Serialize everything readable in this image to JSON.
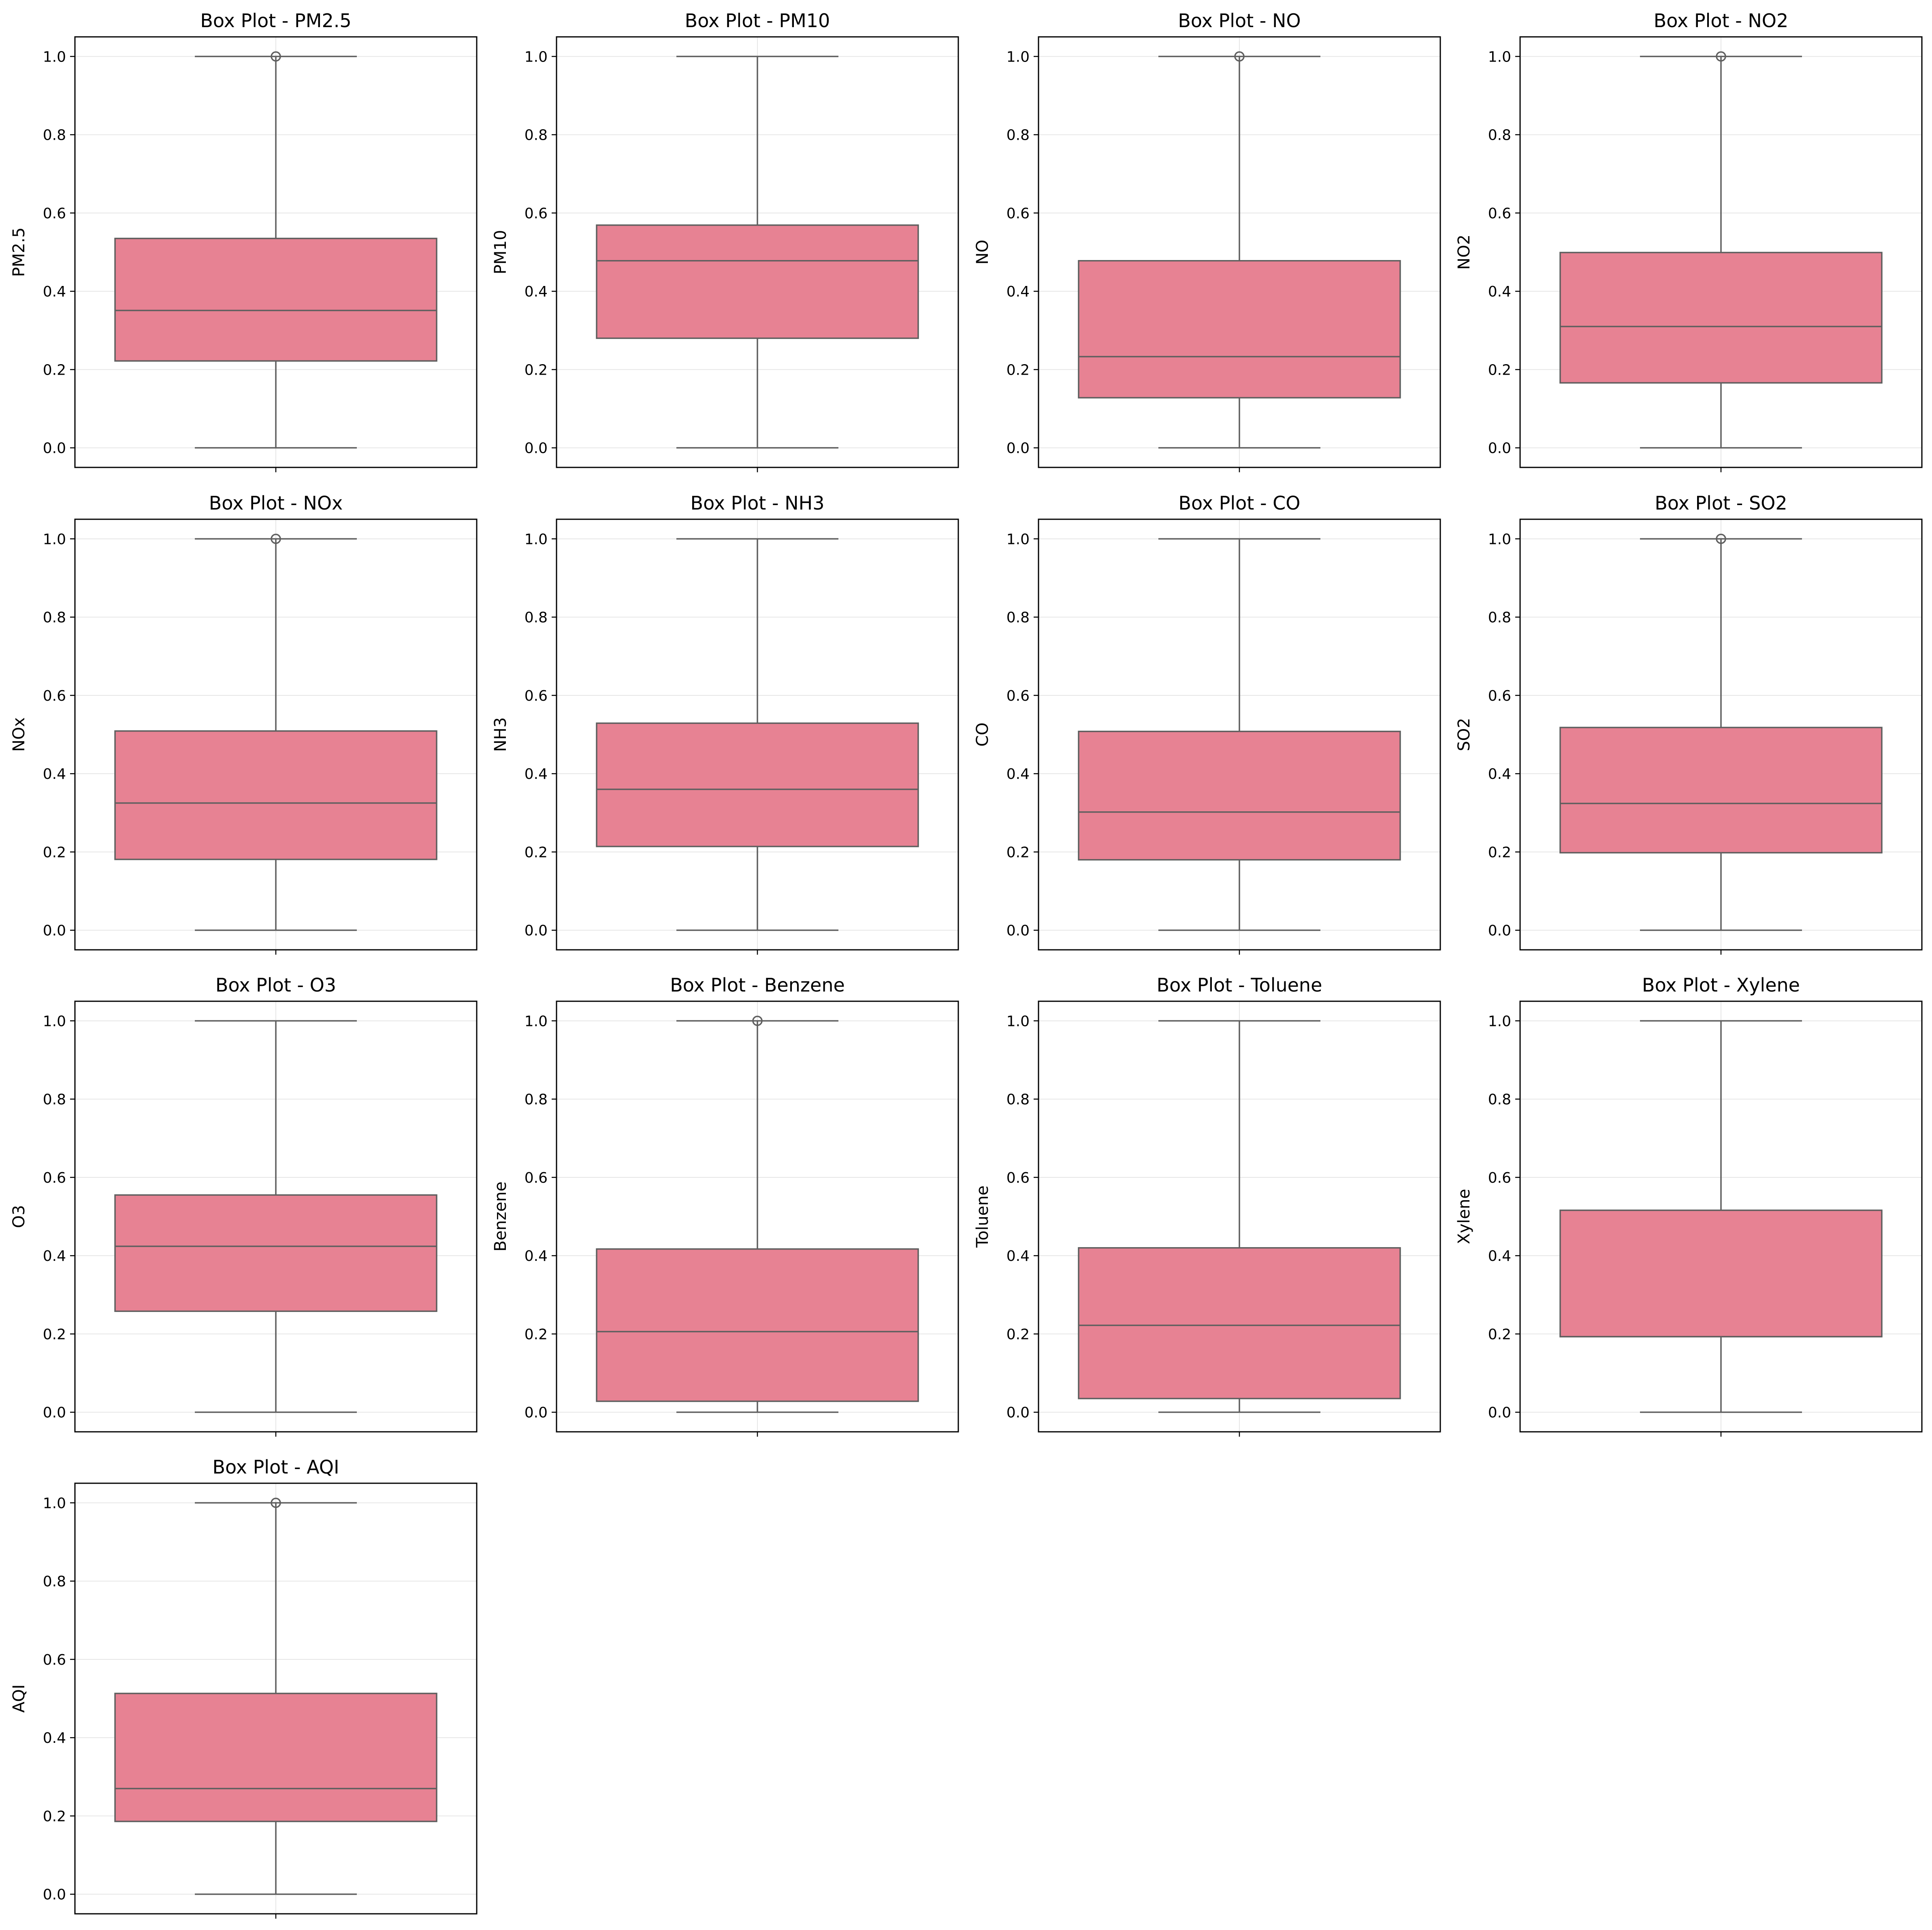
{
  "figure": {
    "box_color": "#e78293",
    "line_color": "#5f5f5f",
    "grid_color": "#e6e6e6",
    "spine_color": "#000000"
  },
  "chart_data": [
    {
      "type": "box",
      "title": "Box Plot - PM2.5",
      "ylabel": "PM2.5",
      "ylim": [
        -0.05,
        1.05
      ],
      "yticks": [
        "0.0",
        "0.2",
        "0.4",
        "0.6",
        "0.8",
        "1.0"
      ],
      "grid": true,
      "whisker_low": 0.0,
      "q1": 0.222,
      "median": 0.351,
      "q3": 0.535,
      "whisker_high": 1.0,
      "outliers": [
        1.0
      ]
    },
    {
      "type": "box",
      "title": "Box Plot - PM10",
      "ylabel": "PM10",
      "ylim": [
        -0.05,
        1.05
      ],
      "yticks": [
        "0.0",
        "0.2",
        "0.4",
        "0.6",
        "0.8",
        "1.0"
      ],
      "grid": true,
      "whisker_low": 0.0,
      "q1": 0.28,
      "median": 0.478,
      "q3": 0.569,
      "whisker_high": 1.0,
      "outliers": []
    },
    {
      "type": "box",
      "title": "Box Plot - NO",
      "ylabel": "NO",
      "ylim": [
        -0.05,
        1.05
      ],
      "yticks": [
        "0.0",
        "0.2",
        "0.4",
        "0.6",
        "0.8",
        "1.0"
      ],
      "grid": true,
      "whisker_low": 0.0,
      "q1": 0.128,
      "median": 0.233,
      "q3": 0.478,
      "whisker_high": 1.0,
      "outliers": [
        1.0
      ]
    },
    {
      "type": "box",
      "title": "Box Plot - NO2",
      "ylabel": "NO2",
      "ylim": [
        -0.05,
        1.05
      ],
      "yticks": [
        "0.0",
        "0.2",
        "0.4",
        "0.6",
        "0.8",
        "1.0"
      ],
      "grid": true,
      "whisker_low": 0.0,
      "q1": 0.166,
      "median": 0.31,
      "q3": 0.499,
      "whisker_high": 1.0,
      "outliers": [
        1.0
      ]
    },
    {
      "type": "box",
      "title": "Box Plot - NOx",
      "ylabel": "NOx",
      "ylim": [
        -0.05,
        1.05
      ],
      "yticks": [
        "0.0",
        "0.2",
        "0.4",
        "0.6",
        "0.8",
        "1.0"
      ],
      "grid": true,
      "whisker_low": 0.0,
      "q1": 0.181,
      "median": 0.325,
      "q3": 0.509,
      "whisker_high": 1.0,
      "outliers": [
        1.0
      ]
    },
    {
      "type": "box",
      "title": "Box Plot - NH3",
      "ylabel": "NH3",
      "ylim": [
        -0.05,
        1.05
      ],
      "yticks": [
        "0.0",
        "0.2",
        "0.4",
        "0.6",
        "0.8",
        "1.0"
      ],
      "grid": true,
      "whisker_low": 0.0,
      "q1": 0.214,
      "median": 0.36,
      "q3": 0.529,
      "whisker_high": 1.0,
      "outliers": []
    },
    {
      "type": "box",
      "title": "Box Plot - CO",
      "ylabel": "CO",
      "ylim": [
        -0.05,
        1.05
      ],
      "yticks": [
        "0.0",
        "0.2",
        "0.4",
        "0.6",
        "0.8",
        "1.0"
      ],
      "grid": true,
      "whisker_low": 0.0,
      "q1": 0.18,
      "median": 0.302,
      "q3": 0.508,
      "whisker_high": 1.0,
      "outliers": []
    },
    {
      "type": "box",
      "title": "Box Plot - SO2",
      "ylabel": "SO2",
      "ylim": [
        -0.05,
        1.05
      ],
      "yticks": [
        "0.0",
        "0.2",
        "0.4",
        "0.6",
        "0.8",
        "1.0"
      ],
      "grid": true,
      "whisker_low": 0.0,
      "q1": 0.198,
      "median": 0.324,
      "q3": 0.518,
      "whisker_high": 1.0,
      "outliers": [
        1.0
      ]
    },
    {
      "type": "box",
      "title": "Box Plot - O3",
      "ylabel": "O3",
      "ylim": [
        -0.05,
        1.05
      ],
      "yticks": [
        "0.0",
        "0.2",
        "0.4",
        "0.6",
        "0.8",
        "1.0"
      ],
      "grid": true,
      "whisker_low": 0.0,
      "q1": 0.258,
      "median": 0.424,
      "q3": 0.555,
      "whisker_high": 1.0,
      "outliers": []
    },
    {
      "type": "box",
      "title": "Box Plot - Benzene",
      "ylabel": "Benzene",
      "ylim": [
        -0.05,
        1.05
      ],
      "yticks": [
        "0.0",
        "0.2",
        "0.4",
        "0.6",
        "0.8",
        "1.0"
      ],
      "grid": true,
      "whisker_low": 0.0,
      "q1": 0.028,
      "median": 0.206,
      "q3": 0.417,
      "whisker_high": 1.0,
      "outliers": [
        1.0
      ]
    },
    {
      "type": "box",
      "title": "Box Plot - Toluene",
      "ylabel": "Toluene",
      "ylim": [
        -0.05,
        1.05
      ],
      "yticks": [
        "0.0",
        "0.2",
        "0.4",
        "0.6",
        "0.8",
        "1.0"
      ],
      "grid": true,
      "whisker_low": 0.0,
      "q1": 0.035,
      "median": 0.222,
      "q3": 0.42,
      "whisker_high": 1.0,
      "outliers": []
    },
    {
      "type": "box",
      "title": "Box Plot - Xylene",
      "ylabel": "Xylene",
      "ylim": [
        -0.05,
        1.05
      ],
      "yticks": [
        "0.0",
        "0.2",
        "0.4",
        "0.6",
        "0.8",
        "1.0"
      ],
      "grid": true,
      "whisker_low": 0.0,
      "q1": 0.193,
      "median": 0.193,
      "q3": 0.516,
      "whisker_high": 1.0,
      "outliers": []
    },
    {
      "type": "box",
      "title": "Box Plot - AQI",
      "ylabel": "AQI",
      "ylim": [
        -0.05,
        1.05
      ],
      "yticks": [
        "0.0",
        "0.2",
        "0.4",
        "0.6",
        "0.8",
        "1.0"
      ],
      "grid": true,
      "whisker_low": 0.0,
      "q1": 0.186,
      "median": 0.27,
      "q3": 0.513,
      "whisker_high": 1.0,
      "outliers": [
        1.0
      ]
    }
  ]
}
